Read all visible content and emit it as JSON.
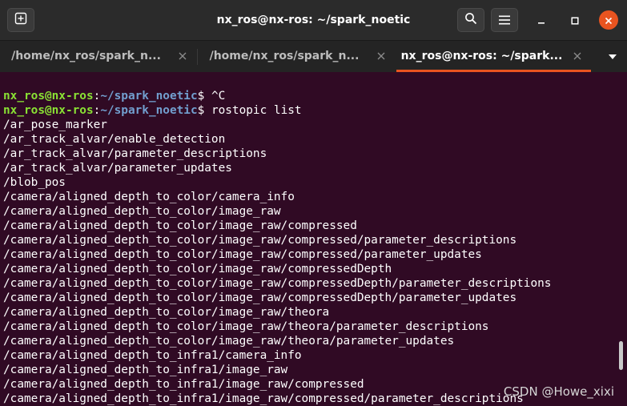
{
  "window": {
    "title": "nx_ros@nx-ros: ~/spark_noetic"
  },
  "tabs": [
    {
      "label": "/home/nx_ros/spark_n...",
      "active": false
    },
    {
      "label": "/home/nx_ros/spark_n...",
      "active": false
    },
    {
      "label": "nx_ros@nx-ros: ~/spark...",
      "active": true
    }
  ],
  "icons": {
    "new_tab": "new-tab-icon",
    "search": "search-icon",
    "menu": "hamburger-menu-icon",
    "minimize": "minimize-icon",
    "maximize": "maximize-icon",
    "close": "close-icon",
    "tab_close": "close-icon",
    "tab_list": "chevron-down-icon"
  },
  "colors": {
    "terminal_bg": "#300a24",
    "prompt_user": "#8ae234",
    "prompt_path": "#729fcf",
    "accent": "#e95420"
  },
  "terminal": {
    "prompt": {
      "user_host": "nx_ros@nx-ros",
      "colon": ":",
      "path": "~/spark_noetic",
      "symbol": "$"
    },
    "commands": [
      " ^C",
      " rostopic list"
    ],
    "output": [
      "/ar_pose_marker",
      "/ar_track_alvar/enable_detection",
      "/ar_track_alvar/parameter_descriptions",
      "/ar_track_alvar/parameter_updates",
      "/blob_pos",
      "/camera/aligned_depth_to_color/camera_info",
      "/camera/aligned_depth_to_color/image_raw",
      "/camera/aligned_depth_to_color/image_raw/compressed",
      "/camera/aligned_depth_to_color/image_raw/compressed/parameter_descriptions",
      "/camera/aligned_depth_to_color/image_raw/compressed/parameter_updates",
      "/camera/aligned_depth_to_color/image_raw/compressedDepth",
      "/camera/aligned_depth_to_color/image_raw/compressedDepth/parameter_descriptions",
      "/camera/aligned_depth_to_color/image_raw/compressedDepth/parameter_updates",
      "/camera/aligned_depth_to_color/image_raw/theora",
      "/camera/aligned_depth_to_color/image_raw/theora/parameter_descriptions",
      "/camera/aligned_depth_to_color/image_raw/theora/parameter_updates",
      "/camera/aligned_depth_to_infra1/camera_info",
      "/camera/aligned_depth_to_infra1/image_raw",
      "/camera/aligned_depth_to_infra1/image_raw/compressed",
      "/camera/aligned_depth_to_infra1/image_raw/compressed/parameter_descriptions"
    ]
  },
  "watermark": "CSDN @Howe_xixi"
}
